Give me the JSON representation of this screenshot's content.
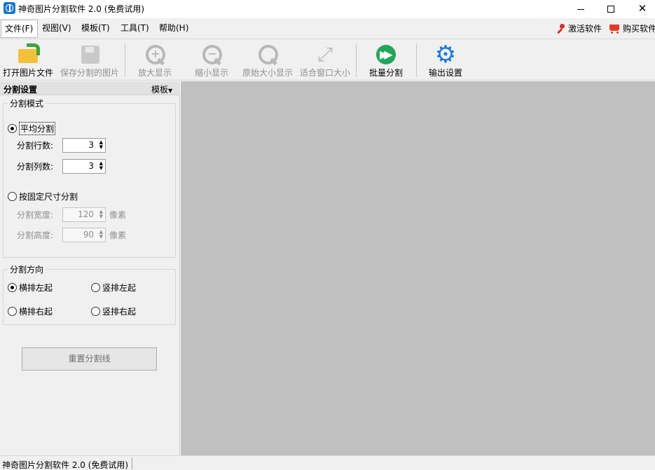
{
  "window": {
    "title": "神奇图片分割软件 2.0 (免费试用)",
    "minimize_glyph": "",
    "close_glyph": "✕"
  },
  "menu": {
    "file": "文件(F)",
    "view": "视图(V)",
    "template": "模板(T)",
    "tools": "工具(T)",
    "help": "帮助(H)",
    "activate": "激活软件",
    "buy": "购买软件"
  },
  "toolbar": {
    "open": "打开图片文件",
    "save": "保存分割的图片",
    "zoom_in": "放大显示",
    "zoom_out": "缩小显示",
    "original": "原始大小显示",
    "fit": "适合窗口大小",
    "batch": "批量分割",
    "output": "输出设置"
  },
  "panel": {
    "title": "分割设置",
    "template_dropdown": "模板",
    "mode_group": {
      "title": "分割模式",
      "equal_label": "平均分割",
      "equal_selected": true,
      "rows_label": "分割行数:",
      "rows_value": "3",
      "cols_label": "分割列数:",
      "cols_value": "3",
      "fixed_label": "按固定尺寸分割",
      "fixed_selected": false,
      "width_label": "分割宽度:",
      "width_value": "120",
      "height_label": "分割高度:",
      "height_value": "90",
      "unit": "像素"
    },
    "direction_group": {
      "title": "分割方向",
      "options": [
        {
          "label": "横排左起",
          "selected": true
        },
        {
          "label": "竖排左起",
          "selected": false
        },
        {
          "label": "横排右起",
          "selected": false
        },
        {
          "label": "竖排右起",
          "selected": false
        }
      ]
    },
    "reset_button": "重置分割线"
  },
  "status": {
    "text": "神奇图片分割软件 2.0 (免费试用)"
  },
  "colors": {
    "canvas_bg": "#c0c0c0",
    "accent_blue": "#1a78d8",
    "batch_green": "#23a55a",
    "cart_red": "#e53a2a"
  },
  "icons": {
    "app": "app-icon",
    "open": "folder-open-icon",
    "save": "floppy-disk-icon",
    "zoom_in": "zoom-in-icon",
    "zoom_out": "zoom-out-icon",
    "original": "magnifier-icon",
    "fit": "fit-window-icon",
    "batch": "fast-forward-icon",
    "output": "gear-icon",
    "activate": "key-icon",
    "buy": "shopping-cart-icon"
  }
}
